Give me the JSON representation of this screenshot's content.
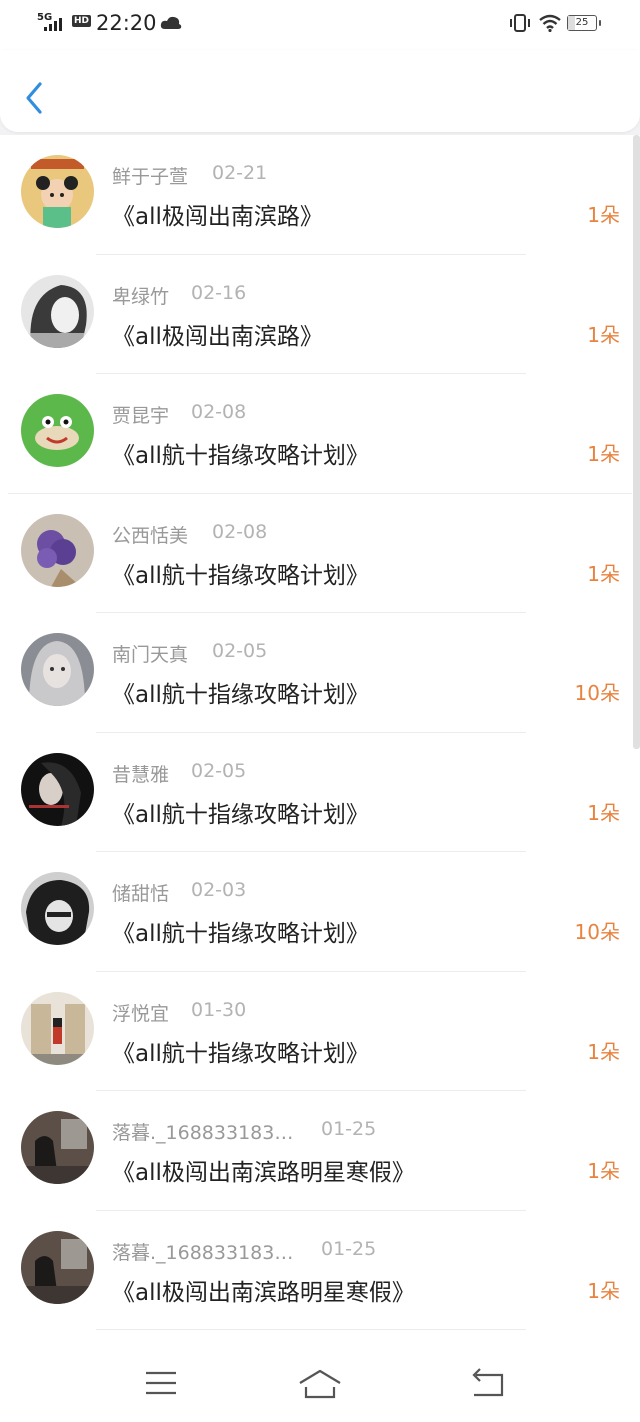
{
  "status_bar": {
    "network": "5G",
    "hd_badge": "HD",
    "time": "22:20",
    "battery": "25"
  },
  "header": {
    "back_icon": "chevron-left-icon",
    "accent_color": "#2f8ee0"
  },
  "gifts": [
    {
      "name": "鲜于子萱",
      "date": "02-21",
      "title": "《all极闯出南滨路》",
      "amount": "1朵",
      "avatar": "cartoon-girl"
    },
    {
      "name": "卑绿竹",
      "date": "02-16",
      "title": "《all极闯出南滨路》",
      "amount": "1朵",
      "avatar": "bw-girl"
    },
    {
      "name": "贾昆宇",
      "date": "02-08",
      "title": "《all航十指缘攻略计划》",
      "amount": "1朵",
      "avatar": "green-frog"
    },
    {
      "name": "公西恬美",
      "date": "02-08",
      "title": "《all航十指缘攻略计划》",
      "amount": "1朵",
      "avatar": "lavender-bouquet"
    },
    {
      "name": "南门天真",
      "date": "02-05",
      "title": "《all航十指缘攻略计划》",
      "amount": "10朵",
      "avatar": "anime-girl"
    },
    {
      "name": "昔慧雅",
      "date": "02-05",
      "title": "《all航十指缘攻略计划》",
      "amount": "1朵",
      "avatar": "dark-portrait"
    },
    {
      "name": "储甜恬",
      "date": "02-03",
      "title": "《all航十指缘攻略计划》",
      "amount": "10朵",
      "avatar": "bw-boy"
    },
    {
      "name": "浮悦宜",
      "date": "01-30",
      "title": "《all航十指缘攻略计划》",
      "amount": "1朵",
      "avatar": "guard-photo"
    },
    {
      "name": "落暮._168833183…",
      "date": "01-25",
      "title": "《all极闯出南滨路明星寒假》",
      "amount": "1朵",
      "avatar": "room-photo"
    },
    {
      "name": "落暮._168833183…",
      "date": "01-25",
      "title": "《all极闯出南滨路明星寒假》",
      "amount": "1朵",
      "avatar": "room-photo"
    }
  ],
  "nav_bar": {
    "icons": [
      "menu-icon",
      "home-icon",
      "back-icon"
    ]
  },
  "colors": {
    "amount": "#e8833f",
    "name": "#999999",
    "title": "#222222"
  }
}
